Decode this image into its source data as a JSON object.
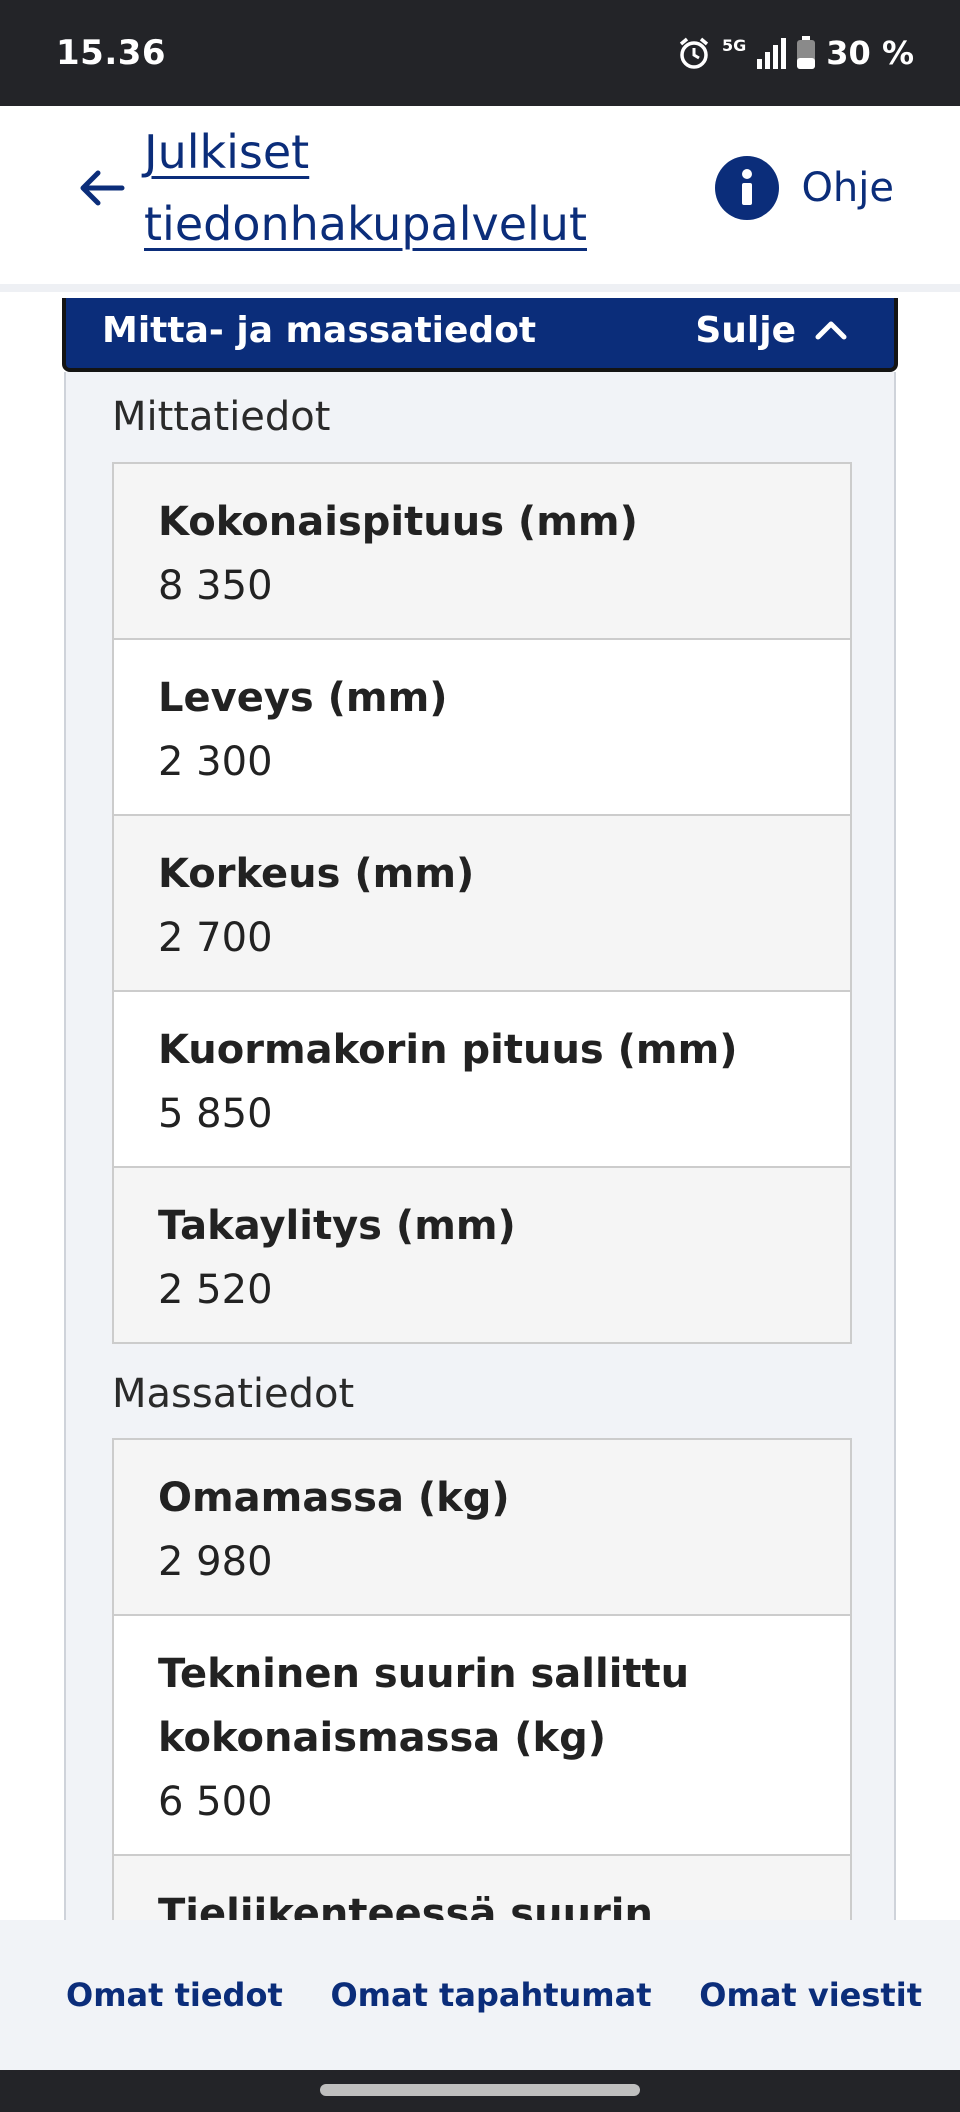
{
  "status_bar": {
    "time": "15.36",
    "network": "5G",
    "battery": "30 %"
  },
  "header": {
    "back_icon": "arrow-left-icon",
    "link_line1": "Julkiset",
    "link_line2": "tiedonhakupalvelut",
    "help_icon": "info-icon",
    "help_label": "Ohje"
  },
  "accordion": {
    "title": "Mitta- ja massatiedot",
    "close_label": "Sulje",
    "close_icon": "chevron-up-icon"
  },
  "dimensions": {
    "title": "Mittatiedot",
    "rows": [
      {
        "label": "Kokonaispituus (mm)",
        "value": "8 350"
      },
      {
        "label": "Leveys (mm)",
        "value": "2 300"
      },
      {
        "label": "Korkeus (mm)",
        "value": "2 700"
      },
      {
        "label": "Kuormakorin pituus (mm)",
        "value": "5 850"
      },
      {
        "label": "Takaylitys (mm)",
        "value": "2 520"
      }
    ]
  },
  "masses": {
    "title": "Massatiedot",
    "rows": [
      {
        "label": "Omamassa (kg)",
        "value": "2 980"
      },
      {
        "label": "Tekninen suurin sallittu kokonaismassa (kg)",
        "value": "6 500"
      },
      {
        "label": "Tieliikenteessä suurin sallittu",
        "value": ""
      }
    ]
  },
  "bottom_nav": {
    "item1": "Omat tiedot",
    "item2": "Omat tapahtumat",
    "item3": "Omat viestit"
  },
  "colors": {
    "brand": "#0b2d7a",
    "status_bar": "#232428",
    "panel": "#f1f3f7"
  }
}
